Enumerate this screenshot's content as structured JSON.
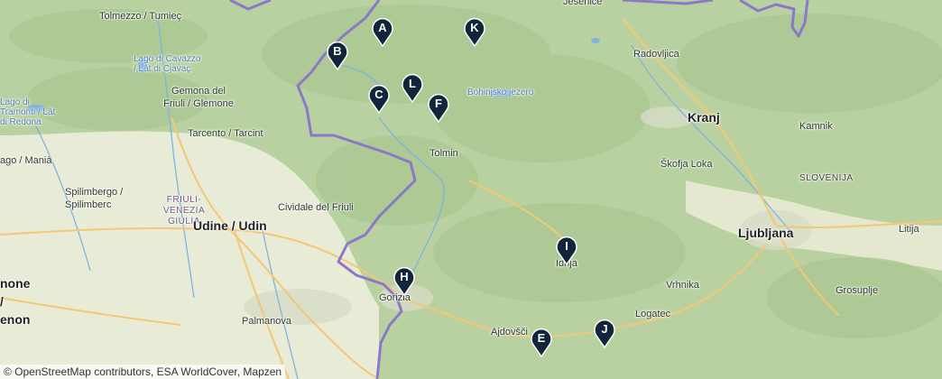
{
  "map": {
    "attribution": "© OpenStreetMap contributors, ESA WorldCover, Mapzen",
    "colors": {
      "terrain": "#bcd3a3",
      "lowland": "#e9ecd8",
      "water": "#7fb3e0",
      "border": "#8b78c6",
      "road": "#f2c777"
    },
    "places": {
      "tolmezzo": "Tolmezzo / Tumieç",
      "jesenice": "Jesenice",
      "lago_cavazzo": "Lago di Cavazzo / Lât di Cjavaç",
      "radovljica": "Radovljica",
      "gemona": "Gemona del Friuli / Glemone",
      "lago_tramonti": "Lago di Tramonti / Lât di Redona",
      "bohinjsko": "Bohinjsko jezero",
      "kranj": "Kranj",
      "kamnik": "Kamnik",
      "tarcento": "Tarcento / Tarcint",
      "tolmin": "Tolmin",
      "maniago": "ago / Manià",
      "skofja_loka": "Škofja Loka",
      "slovenija": "SLOVENIJA",
      "spilimbergo": "Spilimbergo / Spilimberc",
      "fvg": "FRIULI-VENEZIA GIULIA",
      "cividale": "Cividale del Friuli",
      "udine": "Udine / Udin",
      "ljubljana": "Ljubljana",
      "litija": "Litija",
      "idrija": "Idrija",
      "pordenone": "none / enon",
      "gorizia": "Gorizia",
      "vrhnika": "Vrhnika",
      "grosuplje": "Grosuplje",
      "palmanova": "Palmanova",
      "logatec": "Logatec",
      "ajdovscina": "Ajdovšči"
    },
    "markers": [
      {
        "id": "A",
        "label": "A"
      },
      {
        "id": "B",
        "label": "B"
      },
      {
        "id": "C",
        "label": "C"
      },
      {
        "id": "E",
        "label": "E"
      },
      {
        "id": "F",
        "label": "F"
      },
      {
        "id": "H",
        "label": "H"
      },
      {
        "id": "I",
        "label": "I"
      },
      {
        "id": "J",
        "label": "J"
      },
      {
        "id": "K",
        "label": "K"
      },
      {
        "id": "L",
        "label": "L"
      }
    ]
  }
}
